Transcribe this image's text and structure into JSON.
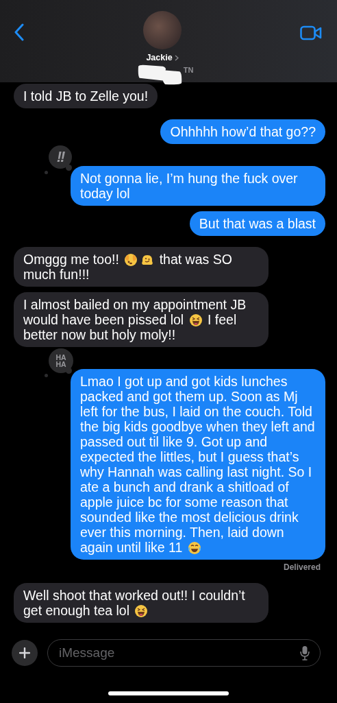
{
  "header": {
    "contact_name": "Jackie",
    "subtitle": "TN"
  },
  "messages": [
    {
      "kind": "received",
      "parts": [
        {
          "kind": "text",
          "text": "I told JB to Zelle you!"
        }
      ]
    },
    {
      "kind": "sent",
      "parts": [
        {
          "kind": "text",
          "text": "Ohhhhh how’d that go??"
        }
      ]
    },
    {
      "kind": "sent",
      "reaction": {
        "kind": "emphasis",
        "label": "!!"
      },
      "parts": [
        {
          "kind": "text",
          "text": "Not gonna lie, I’m hung the fuck over today lol"
        }
      ]
    },
    {
      "kind": "sent",
      "parts": [
        {
          "kind": "text",
          "text": "But that was a blast"
        }
      ]
    },
    {
      "kind": "received",
      "parts": [
        {
          "kind": "text",
          "text": "Omggg me too!!"
        },
        {
          "kind": "peek"
        },
        {
          "kind": "melt"
        },
        {
          "kind": "text",
          "text": "that was SO much fun!!!"
        }
      ]
    },
    {
      "kind": "received",
      "parts": [
        {
          "kind": "text",
          "text": "I almost bailed on my appointment JB would have been pissed lol"
        },
        {
          "kind": "grin"
        },
        {
          "kind": "text",
          "text": "I feel better now but holy moly!!"
        }
      ]
    },
    {
      "kind": "sent",
      "reaction": {
        "kind": "haha",
        "label": "HA HA"
      },
      "receipt": "Delivered",
      "parts": [
        {
          "kind": "text",
          "text": "Lmao I got up and got kids lunches packed and got them up. Soon as Mj left for the bus, I laid on the couch. Told the big kids goodbye when they left and passed out til like 9. Got up and expected the littles, but I guess that’s why Hannah was calling last night. So I ate a bunch and drank a shitload of apple juice bc for some reason that sounded like the most delicious drink ever this morning. Then, laid down again until like 11"
        },
        {
          "kind": "tears"
        }
      ]
    },
    {
      "kind": "received",
      "parts": [
        {
          "kind": "text",
          "text": "Well shoot that worked out!! I couldn’t get enough tea lol"
        },
        {
          "kind": "grin"
        }
      ]
    }
  ],
  "composer": {
    "placeholder": "iMessage"
  }
}
